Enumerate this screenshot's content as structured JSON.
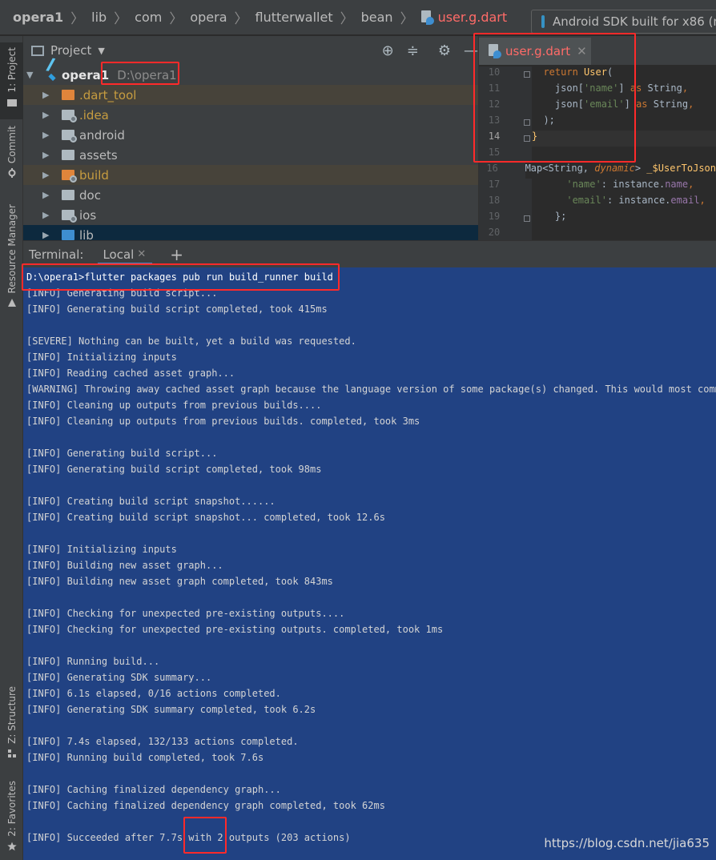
{
  "breadcrumb": {
    "items": [
      "opera1",
      "lib",
      "com",
      "opera",
      "flutterwallet",
      "bean"
    ],
    "file": "user.g.dart"
  },
  "device": {
    "label": "Android SDK built for x86 (m"
  },
  "tool_strip": {
    "project": "1: Project",
    "commit": "Commit",
    "resource_manager": "Resource Manager",
    "structure": "Z: Structure",
    "favorites": "2: Favorites"
  },
  "project_panel": {
    "title": "Project",
    "root": {
      "name": "opera1",
      "path": "D:\\opera1"
    },
    "items": [
      {
        "label": ".dart_tool"
      },
      {
        "label": ".idea"
      },
      {
        "label": "android"
      },
      {
        "label": "assets"
      },
      {
        "label": "build"
      },
      {
        "label": "doc"
      },
      {
        "label": "ios"
      },
      {
        "label": "lib"
      }
    ]
  },
  "editor": {
    "tab_label": "user.g.dart",
    "line_numbers": [
      "10",
      "11",
      "12",
      "13",
      "14",
      "15",
      "16",
      "17",
      "18",
      "19",
      "20"
    ],
    "code": {
      "l10_return": "return ",
      "l10_user": "User",
      "l10_paren": "(",
      "l11_json": "json[",
      "l11_key": "'name'",
      "l11_rest": "] ",
      "l11_as": "as",
      "l11_type": " String",
      "l11_comma": ",",
      "l12_json": "json[",
      "l12_key": "'email'",
      "l12_rest": "] ",
      "l12_as": "as",
      "l12_type": " String",
      "l12_comma": ",",
      "l13": ");",
      "l14": "}",
      "l16_map": "Map<String, ",
      "l16_dyn": "dynamic",
      "l16_rest": "> ",
      "l16_fn": "_$UserToJson",
      "l17_key": "'name'",
      "l17_rest": ": instance.",
      "l17_fld": "name",
      "l17_comma": ",",
      "l18_key": "'email'",
      "l18_rest": ": instance.",
      "l18_fld": "email",
      "l18_comma": ",",
      "l19": "};"
    }
  },
  "terminal": {
    "title": "Terminal:",
    "tab": "Local",
    "lines": [
      "D:\\opera1>flutter packages pub run build_runner build",
      "[INFO] Generating build script...",
      "[INFO] Generating build script completed, took 415ms",
      "",
      "[SEVERE] Nothing can be built, yet a build was requested.",
      "[INFO] Initializing inputs",
      "[INFO] Reading cached asset graph...",
      "[WARNING] Throwing away cached asset graph because the language version of some package(s) changed. This would most commonly",
      "[INFO] Cleaning up outputs from previous builds....",
      "[INFO] Cleaning up outputs from previous builds. completed, took 3ms",
      "",
      "[INFO] Generating build script...",
      "[INFO] Generating build script completed, took 98ms",
      "",
      "[INFO] Creating build script snapshot......",
      "[INFO] Creating build script snapshot... completed, took 12.6s",
      "",
      "[INFO] Initializing inputs",
      "[INFO] Building new asset graph...",
      "[INFO] Building new asset graph completed, took 843ms",
      "",
      "[INFO] Checking for unexpected pre-existing outputs....",
      "[INFO] Checking for unexpected pre-existing outputs. completed, took 1ms",
      "",
      "[INFO] Running build...",
      "[INFO] Generating SDK summary...",
      "[INFO] 6.1s elapsed, 0/16 actions completed.",
      "[INFO] Generating SDK summary completed, took 6.2s",
      "",
      "[INFO] 7.4s elapsed, 132/133 actions completed.",
      "[INFO] Running build completed, took 7.6s",
      "",
      "[INFO] Caching finalized dependency graph...",
      "[INFO] Caching finalized dependency graph completed, took 62ms",
      "",
      "[INFO] Succeeded after 7.7s with 2 outputs (203 actions)"
    ]
  },
  "watermark": "https://blog.csdn.net/jia635"
}
